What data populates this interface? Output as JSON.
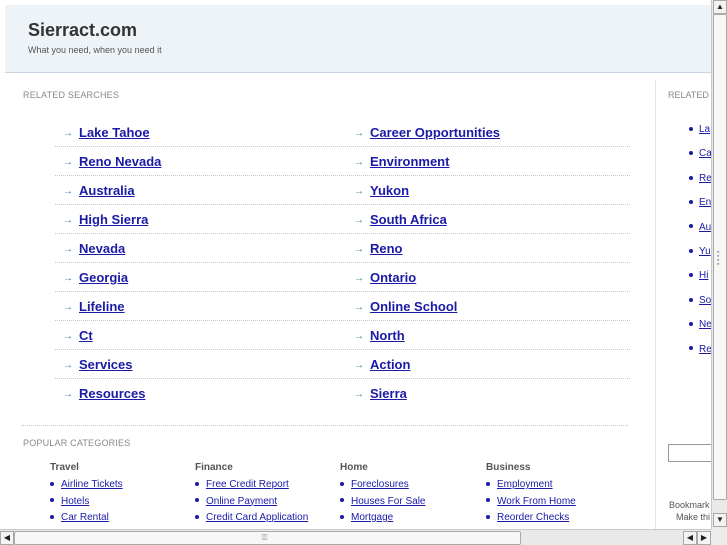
{
  "header": {
    "site_title": "Sierract.com",
    "tagline": "What you need, when you need it"
  },
  "related": {
    "label": "RELATED SEARCHES",
    "left": [
      "Lake Tahoe",
      "Reno Nevada",
      "Australia",
      "High Sierra",
      "Nevada",
      "Georgia",
      "Lifeline",
      "Ct",
      "Services",
      "Resources"
    ],
    "right": [
      "Career Opportunities",
      "Environment",
      "Yukon",
      "South Africa",
      "Reno",
      "Ontario",
      "Online School",
      "North",
      "Action",
      "Sierra"
    ]
  },
  "popular": {
    "label": "POPULAR CATEGORIES",
    "categories": [
      {
        "title": "Travel",
        "items": [
          "Airline Tickets",
          "Hotels",
          "Car Rental"
        ]
      },
      {
        "title": "Finance",
        "items": [
          "Free Credit Report",
          "Online Payment",
          "Credit Card Application"
        ]
      },
      {
        "title": "Home",
        "items": [
          "Foreclosures",
          "Houses For Sale",
          "Mortgage"
        ]
      },
      {
        "title": "Business",
        "items": [
          "Employment",
          "Work From Home",
          "Reorder Checks"
        ]
      }
    ]
  },
  "sidebar": {
    "label": "RELATED",
    "items": [
      "La",
      "Ca",
      "Re",
      "En",
      "Au",
      "Yu",
      "Hi",
      "So",
      "Ne",
      "Re"
    ],
    "bookmark_line1": "Bookmark",
    "bookmark_line2": "Make thi"
  },
  "icons": {
    "bullet_arrow": "→",
    "scroll_up": "▲",
    "scroll_down": "▼",
    "scroll_left": "◀",
    "scroll_right": "▶"
  }
}
